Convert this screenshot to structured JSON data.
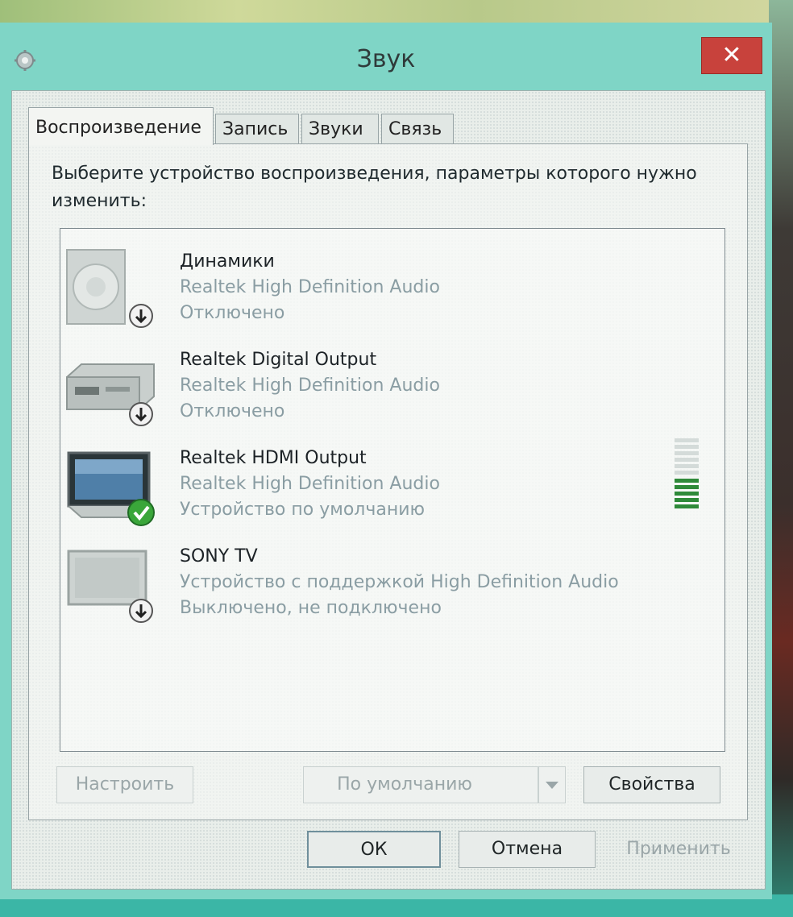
{
  "window": {
    "title": "Звук",
    "close_symbol": "✕"
  },
  "tabs": [
    {
      "label": "Воспроизведение",
      "active": true
    },
    {
      "label": "Запись",
      "active": false
    },
    {
      "label": "Звуки",
      "active": false
    },
    {
      "label": "Связь",
      "active": false
    }
  ],
  "instruction": "Выберите устройство воспроизведения, параметры которого нужно изменить:",
  "devices": [
    {
      "name": "Динамики",
      "driver": "Realtek High Definition Audio",
      "status": "Отключено",
      "icon": "speaker-icon",
      "badge": "disabled-arrow-badge"
    },
    {
      "name": "Realtek Digital Output",
      "driver": "Realtek High Definition Audio",
      "status": "Отключено",
      "icon": "digital-receiver-icon",
      "badge": "disabled-arrow-badge"
    },
    {
      "name": "Realtek HDMI Output",
      "driver": "Realtek High Definition Audio",
      "status": "Устройство по умолчанию",
      "icon": "monitor-icon",
      "badge": "default-check-badge"
    },
    {
      "name": "SONY TV",
      "driver": "Устройство с поддержкой High Definition Audio",
      "status": "Выключено, не подключено",
      "icon": "tv-icon",
      "badge": "disabled-arrow-badge"
    }
  ],
  "buttons": {
    "configure": "Настроить",
    "set_default": "По умолчанию",
    "properties": "Свойства",
    "ok": "ОК",
    "cancel": "Отмена",
    "apply": "Применить"
  },
  "colors": {
    "window_frame": "#7fd5c6",
    "close_button": "#c8423c",
    "meter_green": "#2f8a3a",
    "check_green": "#3aa63a"
  }
}
